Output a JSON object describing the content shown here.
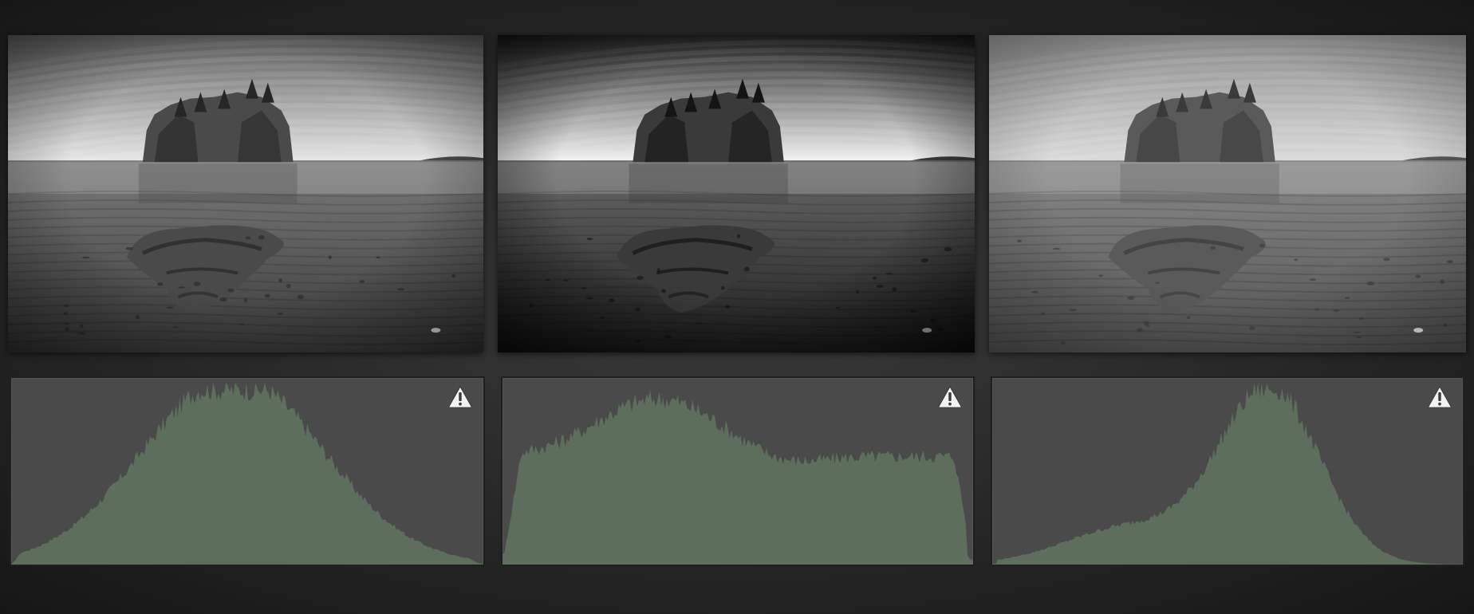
{
  "colors": {
    "background": "#2a2a2a",
    "histogram_bg": "#4a4a4a",
    "histogram_fill": "#5d6e5c",
    "warning_icon": "#f2f2f2"
  },
  "panels": [
    {
      "image": {
        "icon": "landscape-photo",
        "tone": "normal"
      },
      "histogram": {
        "shape": "broad-plateau",
        "warning_icon": "clipping-warning-icon"
      }
    },
    {
      "image": {
        "icon": "landscape-photo",
        "tone": "high-contrast"
      },
      "histogram": {
        "shape": "wide-flat",
        "warning_icon": "clipping-warning-icon"
      }
    },
    {
      "image": {
        "icon": "landscape-photo",
        "tone": "low-contrast"
      },
      "histogram": {
        "shape": "narrow-peak",
        "warning_icon": "clipping-warning-icon"
      }
    }
  ]
}
